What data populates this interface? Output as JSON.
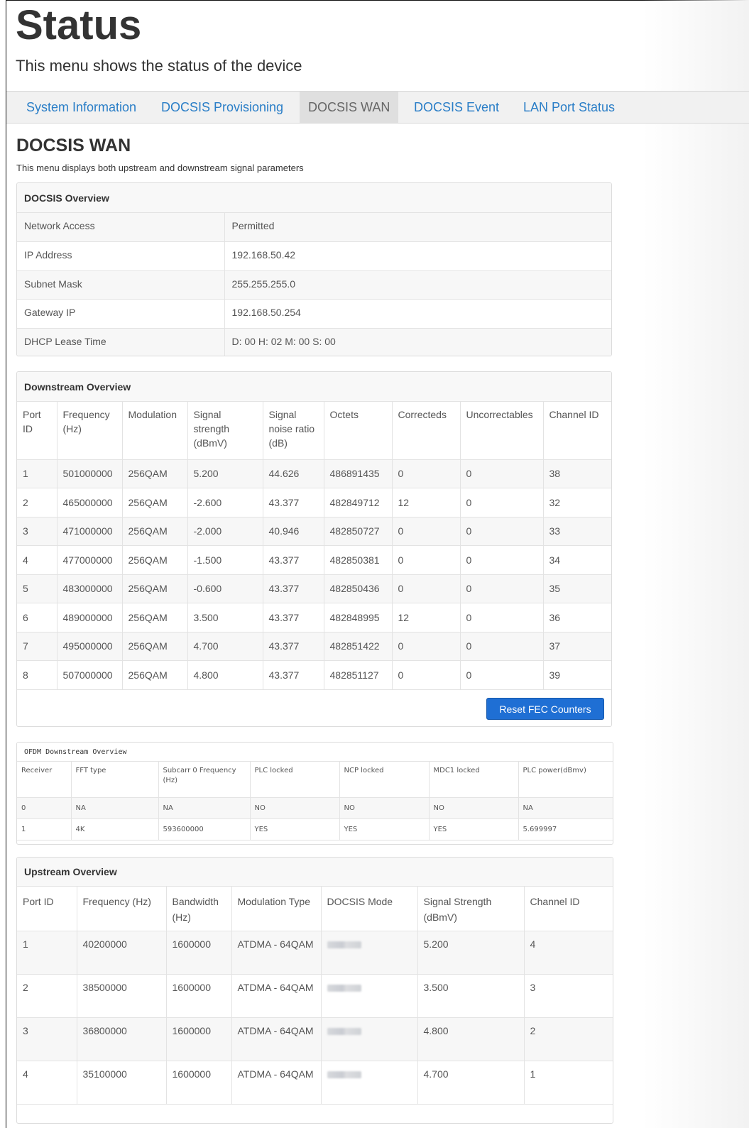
{
  "header": {
    "title": "Status",
    "subtitle": "This menu shows the status of the device"
  },
  "tabs": [
    {
      "label": "System Information",
      "active": false
    },
    {
      "label": "DOCSIS Provisioning",
      "active": false
    },
    {
      "label": "DOCSIS WAN",
      "active": true
    },
    {
      "label": "DOCSIS Event",
      "active": false
    },
    {
      "label": "LAN Port Status",
      "active": false
    }
  ],
  "section": {
    "title": "DOCSIS WAN",
    "description": "This menu displays both upstream and downstream signal parameters"
  },
  "docsis_overview": {
    "title": "DOCSIS Overview",
    "rows": [
      {
        "label": "Network Access",
        "value": "Permitted"
      },
      {
        "label": "IP Address",
        "value": "192.168.50.42"
      },
      {
        "label": "Subnet Mask",
        "value": "255.255.255.0"
      },
      {
        "label": "Gateway IP",
        "value": "192.168.50.254"
      },
      {
        "label": "DHCP Lease Time",
        "value": "D: 00 H: 02 M: 00 S: 00"
      }
    ]
  },
  "downstream": {
    "title": "Downstream Overview",
    "headers": [
      "Port ID",
      "Frequency (Hz)",
      "Modulation",
      "Signal strength (dBmV)",
      "Signal noise ratio (dB)",
      "Octets",
      "Correcteds",
      "Uncorrectables",
      "Channel ID"
    ],
    "rows": [
      [
        "1",
        "501000000",
        "256QAM",
        "5.200",
        "44.626",
        "486891435",
        "0",
        "0",
        "38"
      ],
      [
        "2",
        "465000000",
        "256QAM",
        "-2.600",
        "43.377",
        "482849712",
        "12",
        "0",
        "32"
      ],
      [
        "3",
        "471000000",
        "256QAM",
        "-2.000",
        "40.946",
        "482850727",
        "0",
        "0",
        "33"
      ],
      [
        "4",
        "477000000",
        "256QAM",
        "-1.500",
        "43.377",
        "482850381",
        "0",
        "0",
        "34"
      ],
      [
        "5",
        "483000000",
        "256QAM",
        "-0.600",
        "43.377",
        "482850436",
        "0",
        "0",
        "35"
      ],
      [
        "6",
        "489000000",
        "256QAM",
        "3.500",
        "43.377",
        "482848995",
        "12",
        "0",
        "36"
      ],
      [
        "7",
        "495000000",
        "256QAM",
        "4.700",
        "43.377",
        "482851422",
        "0",
        "0",
        "37"
      ],
      [
        "8",
        "507000000",
        "256QAM",
        "4.800",
        "43.377",
        "482851127",
        "0",
        "0",
        "39"
      ]
    ],
    "reset_button": "Reset FEC Counters"
  },
  "ofdm": {
    "title": "OFDM Downstream Overview",
    "headers": [
      "Receiver",
      "FFT type",
      "Subcarr 0 Frequency (Hz)",
      "PLC locked",
      "NCP locked",
      "MDC1 locked",
      "PLC power(dBmv)"
    ],
    "rows": [
      [
        "0",
        "NA",
        "NA",
        "NO",
        "NO",
        "NO",
        "NA"
      ],
      [
        "1",
        "4K",
        "593600000",
        "YES",
        "YES",
        "YES",
        "5.699997"
      ]
    ]
  },
  "upstream": {
    "title": "Upstream Overview",
    "headers": [
      "Port ID",
      "Frequency (Hz)",
      "Bandwidth (Hz)",
      "Modulation Type",
      "DOCSIS Mode",
      "Signal Strength (dBmV)",
      "Channel ID"
    ],
    "rows": [
      [
        "1",
        "40200000",
        "1600000",
        "ATDMA - 64QAM",
        "",
        "5.200",
        "4"
      ],
      [
        "2",
        "38500000",
        "1600000",
        "ATDMA - 64QAM",
        "",
        "3.500",
        "3"
      ],
      [
        "3",
        "36800000",
        "1600000",
        "ATDMA - 64QAM",
        "",
        "4.800",
        "2"
      ],
      [
        "4",
        "35100000",
        "1600000",
        "ATDMA - 64QAM",
        "",
        "4.700",
        "1"
      ]
    ]
  }
}
